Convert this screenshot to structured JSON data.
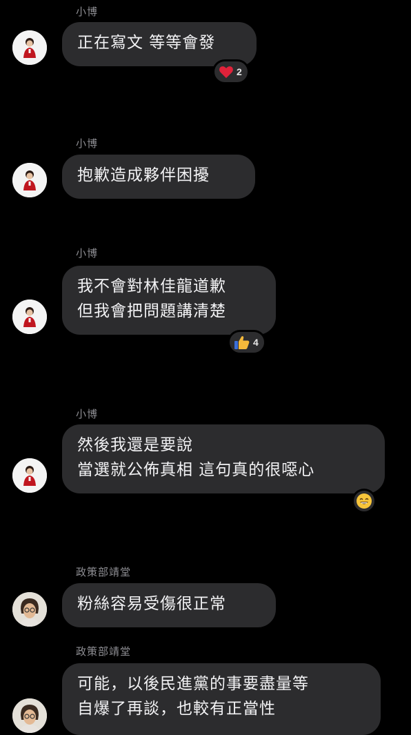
{
  "messages": [
    {
      "sender": "小博",
      "lines": [
        "正在寫文 等等會發"
      ],
      "reaction": {
        "emoji": "heart-icon",
        "count": "2"
      }
    },
    {
      "sender": "小博",
      "lines": [
        "抱歉造成夥伴困擾"
      ]
    },
    {
      "sender": "小博",
      "lines": [
        "我不會對林佳龍道歉",
        "但我會把問題講清楚"
      ],
      "reaction": {
        "emoji": "thumbs-up-icon",
        "count": "4"
      }
    },
    {
      "sender": "小博",
      "lines": [
        "然後我還是要說",
        "當選就公佈真相 這句真的很噁心"
      ],
      "reaction": {
        "emoji": "grinning-face-icon"
      }
    },
    {
      "sender": "政策部靖堂",
      "lines": [
        "粉絲容易受傷很正常"
      ]
    },
    {
      "sender": "政策部靖堂",
      "lines": [
        "可能，以後民進黨的事要盡量等",
        "自爆了再談，也較有正當性"
      ]
    }
  ],
  "colors": {
    "background": "#000000",
    "bubble": "#2c2c2e",
    "sender_text": "#8e8e93",
    "heart": "#e0223a",
    "thumb": "#f5b93b"
  }
}
